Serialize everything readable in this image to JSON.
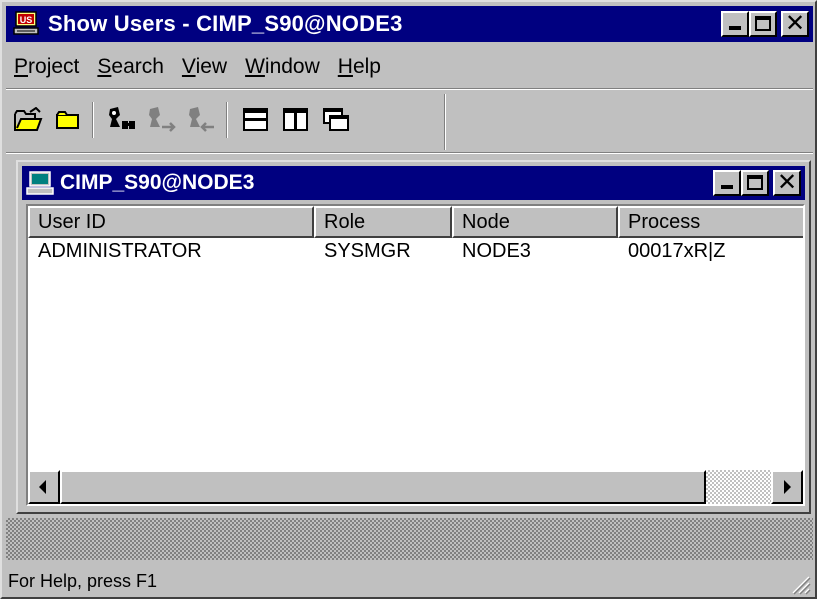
{
  "window": {
    "title": "Show Users - CIMP_S90@NODE3",
    "icon": "show-users-app-icon"
  },
  "menu": [
    {
      "label": "Project",
      "mnemonic": "P",
      "rest": "roject"
    },
    {
      "label": "Search",
      "mnemonic": "S",
      "rest": "earch"
    },
    {
      "label": "View",
      "mnemonic": "V",
      "rest": "iew"
    },
    {
      "label": "Window",
      "mnemonic": "W",
      "rest": "indow"
    },
    {
      "label": "Help",
      "mnemonic": "H",
      "rest": "elp"
    }
  ],
  "toolbar": {
    "buttons": [
      {
        "icon": "open-folder-icon",
        "enabled": true
      },
      {
        "icon": "folder-icon",
        "enabled": true
      },
      {
        "icon": "find-user-icon",
        "enabled": true
      },
      {
        "icon": "user-forward-icon",
        "enabled": false
      },
      {
        "icon": "user-back-icon",
        "enabled": false
      },
      {
        "icon": "tile-horizontal-icon",
        "enabled": true
      },
      {
        "icon": "tile-vertical-icon",
        "enabled": true
      },
      {
        "icon": "cascade-icon",
        "enabled": true
      }
    ]
  },
  "child_window": {
    "title": "CIMP_S90@NODE3",
    "icon": "computer-icon"
  },
  "table": {
    "columns": [
      "User ID",
      "Role",
      "Node",
      "Process"
    ],
    "rows": [
      [
        "ADMINISTRATOR",
        "SYSMGR",
        "NODE3",
        "00017xR|Z"
      ]
    ]
  },
  "status": {
    "text": "For Help, press F1"
  },
  "colors": {
    "titlebar": "#000080",
    "face": "#c0c0c0",
    "window": "#ffffff"
  }
}
